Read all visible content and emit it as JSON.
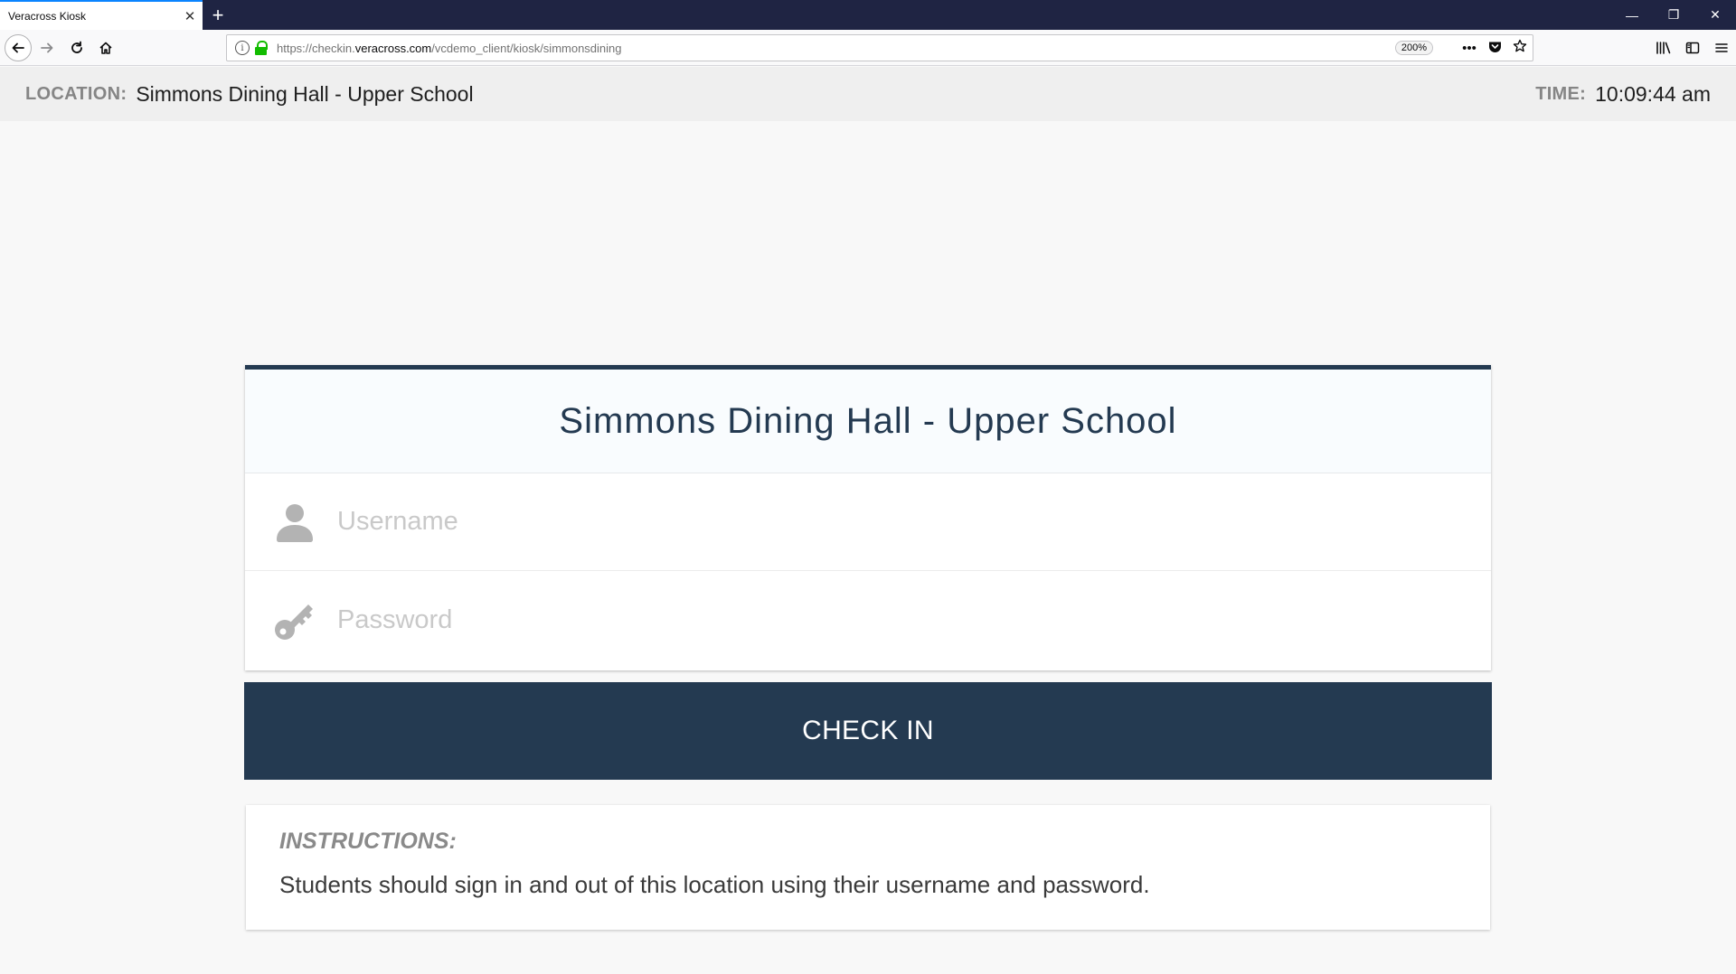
{
  "browser": {
    "tab_title": "Veracross Kiosk",
    "tab_close": "✕",
    "new_tab": "+",
    "window_controls": {
      "minimize": "—",
      "restore": "❐",
      "close": "✕"
    },
    "url_prefix": "https://checkin.",
    "url_domain": "veracross.com",
    "url_path": "/vcdemo_client/kiosk/simmonsdining",
    "zoom": "200%",
    "url_more": "•••",
    "icons": [
      "back-arrow-icon",
      "forward-arrow-icon",
      "reload-icon",
      "home-icon",
      "info-icon",
      "lock-icon",
      "pocket-icon",
      "star-icon",
      "library-icon",
      "sidebar-icon",
      "menu-icon"
    ]
  },
  "header": {
    "location_label": "LOCATION:",
    "location_value": "Simmons Dining Hall - Upper School",
    "time_label": "TIME:",
    "time_value": "10:09:44 am"
  },
  "card": {
    "title": "Simmons Dining Hall - Upper School",
    "username_placeholder": "Username",
    "password_placeholder": "Password"
  },
  "checkin_label": "CHECK IN",
  "instructions": {
    "label": "INSTRUCTIONS:",
    "text": "Students should sign in and out of this location using their username and password."
  },
  "colors": {
    "primary": "#243a51",
    "icon_gray": "#b3b3b3",
    "lock_green": "#12bc00"
  }
}
